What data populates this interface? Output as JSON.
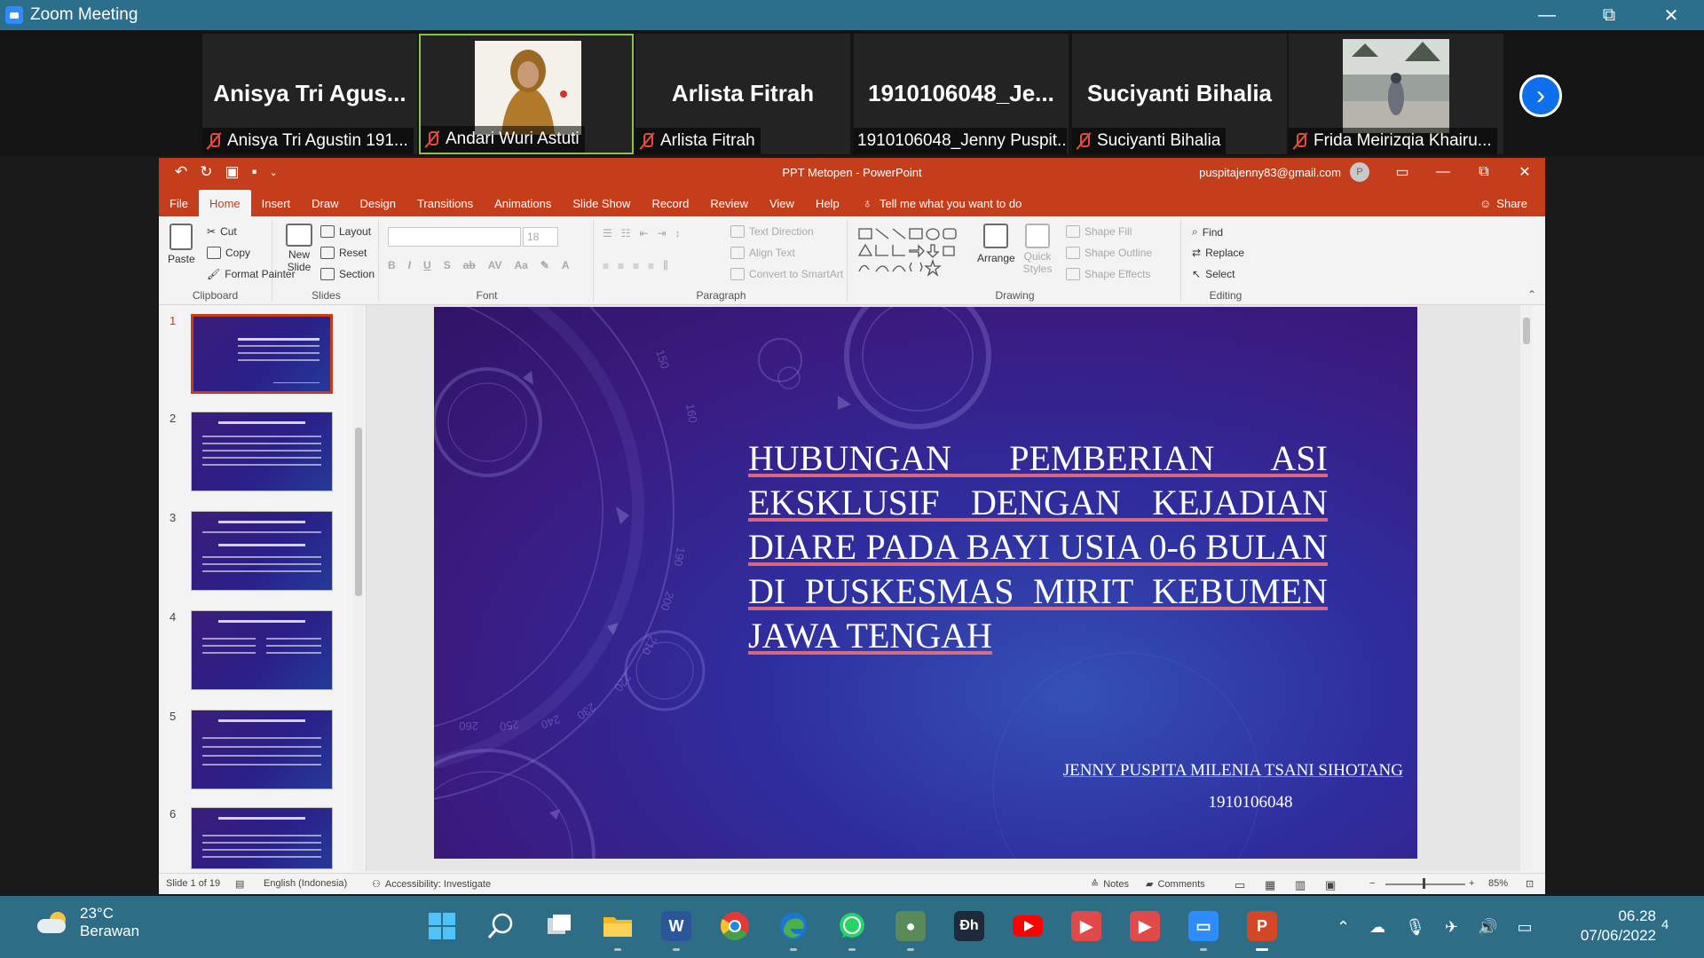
{
  "zoom": {
    "window_title": "Zoom Meeting",
    "controls": [
      "—",
      "⧉",
      "✕"
    ],
    "participants": [
      {
        "display_name": "Anisya  Tri  Agus...",
        "label": "Anisya Tri Agustin 191...",
        "muted": true,
        "video": false
      },
      {
        "display_name": "",
        "label": "Andari Wuri Astuti",
        "muted": true,
        "video": true,
        "active": true
      },
      {
        "display_name": "Arlista Fitrah",
        "label": "Arlista Fitrah",
        "muted": true,
        "video": false
      },
      {
        "display_name": "1910106048_Je...",
        "label": "1910106048_Jenny Puspit...",
        "muted": false,
        "video": false
      },
      {
        "display_name": "Suciyanti Bihalia",
        "label": "Suciyanti Bihalia",
        "muted": true,
        "video": false
      },
      {
        "display_name": "",
        "label": "Frida Meirizqia Khairu...",
        "muted": true,
        "video": true
      }
    ],
    "next_icon": "›"
  },
  "powerpoint": {
    "doc_title": "PPT Metopen  -  PowerPoint",
    "account": "puspitajenny83@gmail.com",
    "avatar_initial": "P",
    "tabs": [
      "File",
      "Home",
      "Insert",
      "Draw",
      "Design",
      "Transitions",
      "Animations",
      "Slide Show",
      "Record",
      "Review",
      "View",
      "Help"
    ],
    "selected_tab": "Home",
    "tell_me": "Tell me what you want to do",
    "share": "Share",
    "ribbon": {
      "clipboard": {
        "paste": "Paste",
        "cut": "Cut",
        "copy": "Copy",
        "format_painter": "Format Painter",
        "label": "Clipboard"
      },
      "slides": {
        "new_slide": "New Slide",
        "layout": "Layout",
        "reset": "Reset",
        "section": "Section",
        "label": "Slides"
      },
      "font": {
        "font_size": "18",
        "label": "Font"
      },
      "paragraph": {
        "text_direction": "Text Direction",
        "align_text": "Align Text",
        "convert_smartart": "Convert to SmartArt",
        "label": "Paragraph"
      },
      "drawing": {
        "arrange": "Arrange",
        "quick_styles": "Quick Styles",
        "shape_fill": "Shape Fill",
        "shape_outline": "Shape Outline",
        "shape_effects": "Shape Effects",
        "label": "Drawing"
      },
      "editing": {
        "find": "Find",
        "replace": "Replace",
        "select": "Select",
        "label": "Editing"
      }
    },
    "thumbnails": [
      {
        "num": "1",
        "title": "HUBUNGAN PEMBERIAN ASI EKSKLUSIF DENGAN KEJADIAN DIARE PADA BAYI USIA 0-6 BULAN DI PUSKESMAS MIRIT KEBUMEN JAWA TENGAH"
      },
      {
        "num": "2",
        "title": "LATAR BELAKANG"
      },
      {
        "num": "3",
        "title": "RUMUSAN MASALAH"
      },
      {
        "num": "4",
        "title": "RUANG LINGKUP"
      },
      {
        "num": "5",
        "title": "KEASLIAN PENELITIAN"
      },
      {
        "num": "6",
        "title": "TINJAUAN TEORI"
      }
    ],
    "slide": {
      "title": "HUBUNGAN PEMBERIAN ASI EKSKLUSIF DENGAN KEJADIAN DIARE PADA BAYI USIA 0-6 BULAN DI PUSKESMAS MIRIT KEBUMEN JAWA TENGAH",
      "author": "JENNY PUSPITA MILENIA TSANI SIHOTANG",
      "nim": "1910106048",
      "dial_numbers": [
        "150",
        "160",
        "190",
        "200",
        "210",
        "220",
        "230",
        "240",
        "250",
        "260"
      ]
    },
    "status": {
      "slide_count": "Slide 1 of 19",
      "language": "English (Indonesia)",
      "accessibility": "Accessibility: Investigate",
      "notes": "Notes",
      "comments": "Comments",
      "zoom": "85%"
    }
  },
  "taskbar": {
    "temperature": "23°C",
    "condition": "Berawan",
    "apps": [
      "start",
      "search",
      "task-view",
      "file-explorer",
      "word",
      "chrome",
      "edge",
      "whatsapp",
      "app-green",
      "dh",
      "youtube",
      "app-red-1",
      "app-red-2",
      "zoom",
      "powerpoint"
    ],
    "time": "06.28",
    "date": "07/06/2022",
    "notification_count": "4"
  }
}
